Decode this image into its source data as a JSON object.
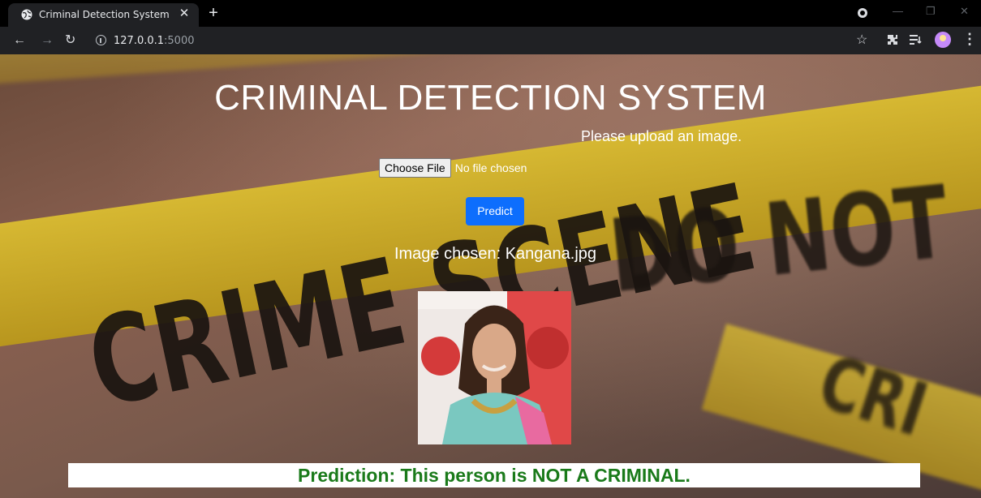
{
  "browser": {
    "tab_title": "Criminal Detection System",
    "url_host": "127.0.0.1",
    "url_port": ":5000"
  },
  "page": {
    "title": "CRIMINAL DETECTION SYSTEM",
    "upload_hint": "Please upload an image.",
    "file_button": "Choose File",
    "file_status": "No file chosen",
    "predict_button": "Predict",
    "image_chosen": "Image chosen: Kangana.jpg",
    "result": "Prediction: This person is NOT A CRIMINAL."
  },
  "background": {
    "tape_words": [
      "CRIME SCENE",
      "DO NOT",
      "CRI"
    ]
  },
  "colors": {
    "predict_button": "#0d6efd",
    "result_text": "#1a7a1a"
  }
}
